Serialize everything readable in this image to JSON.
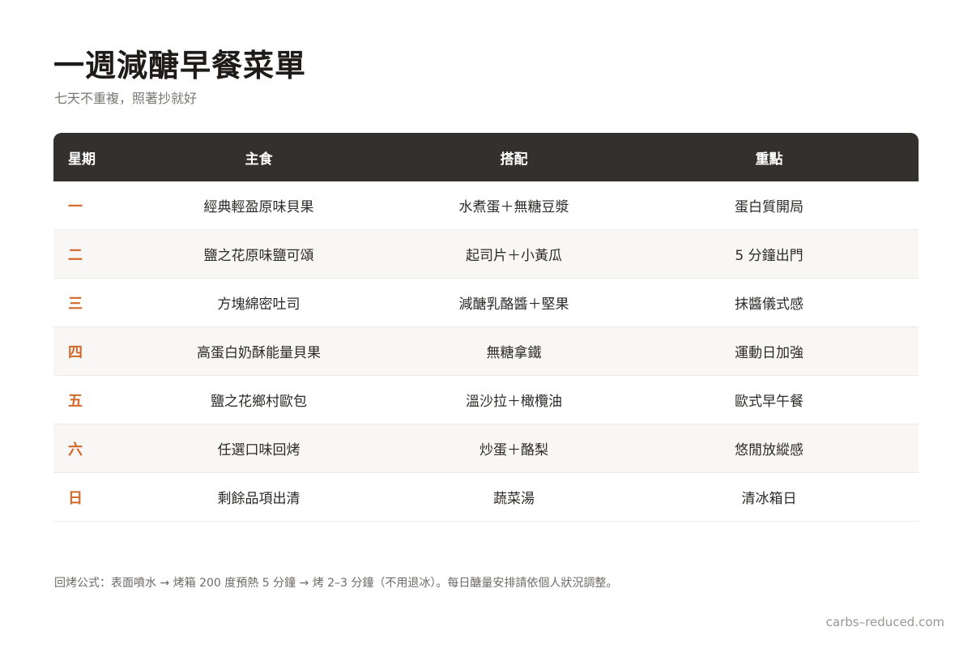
{
  "header": {
    "title": "一週減醣早餐菜單",
    "subtitle": "七天不重複，照著抄就好"
  },
  "table": {
    "columns": [
      "星期",
      "主食",
      "搭配",
      "重點"
    ],
    "rows": [
      {
        "day": "一",
        "main": "經典輕盈原味貝果",
        "pairing": "水煮蛋＋無糖豆漿",
        "focus": "蛋白質開局"
      },
      {
        "day": "二",
        "main": "鹽之花原味鹽可頌",
        "pairing": "起司片＋小黃瓜",
        "focus": "5 分鐘出門"
      },
      {
        "day": "三",
        "main": "方塊綿密吐司",
        "pairing": "減醣乳酪醬＋堅果",
        "focus": "抹醬儀式感"
      },
      {
        "day": "四",
        "main": "高蛋白奶酥能量貝果",
        "pairing": "無糖拿鐵",
        "focus": "運動日加強"
      },
      {
        "day": "五",
        "main": "鹽之花鄉村歐包",
        "pairing": "溫沙拉＋橄欖油",
        "focus": "歐式早午餐"
      },
      {
        "day": "六",
        "main": "任選口味回烤",
        "pairing": "炒蛋＋酪梨",
        "focus": "悠閒放縱感"
      },
      {
        "day": "日",
        "main": "剩餘品項出清",
        "pairing": "蔬菜湯",
        "focus": "清冰箱日"
      }
    ]
  },
  "note": "回烤公式：表面噴水 → 烤箱 200 度預熱 5 分鐘 → 烤 2–3 分鐘（不用退冰）。每日醣量安排請依個人狀況調整。",
  "footer": "carbs–reduced.com",
  "colors": {
    "header_bg": "#34302d",
    "accent": "#d2692a",
    "row_alt": "#f8f7f5"
  }
}
